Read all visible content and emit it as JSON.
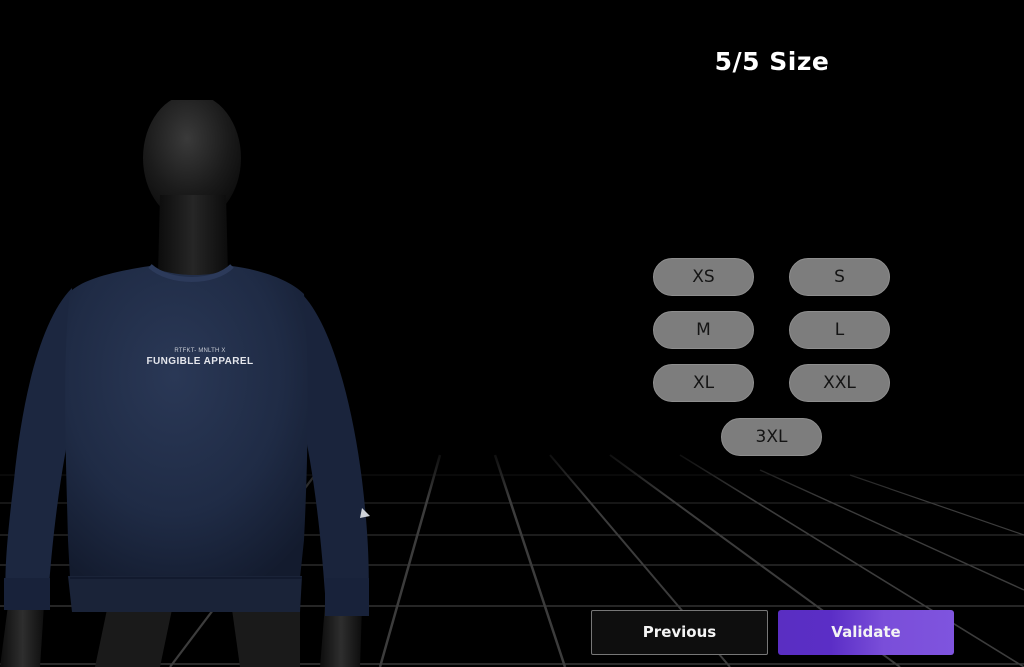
{
  "header": {
    "step_title": "5/5 Size"
  },
  "garment": {
    "print_line1": "RTFKT- MNLTH X",
    "print_line2": "FUNGIBLE APPAREL",
    "color": "#1f2b44"
  },
  "sizes": {
    "options": [
      {
        "label": "XS"
      },
      {
        "label": "S"
      },
      {
        "label": "M"
      },
      {
        "label": "L"
      },
      {
        "label": "XL"
      },
      {
        "label": "XXL"
      },
      {
        "label": "3XL"
      }
    ],
    "selected": null
  },
  "footer": {
    "previous_label": "Previous",
    "validate_label": "Validate"
  },
  "colors": {
    "background": "#000000",
    "pill": "#7d7d7d",
    "accent_start": "#5a2ec2",
    "accent_end": "#7f54de"
  }
}
